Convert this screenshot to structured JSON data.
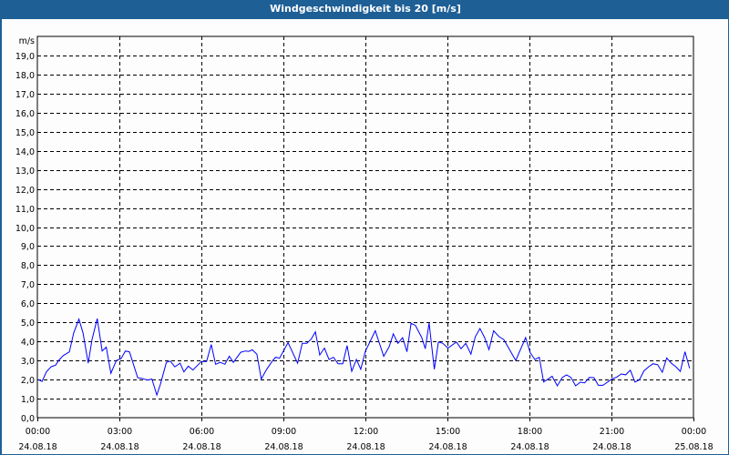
{
  "window": {
    "title": "Windgeschwindigkeit bis 20 [m/s]"
  },
  "chart_data": {
    "type": "line",
    "title": "Windgeschwindigkeit bis 20 [m/s]",
    "ylabel": "m/s",
    "xlabel": "",
    "ylim": [
      0,
      20
    ],
    "xlim_hours": [
      0,
      24
    ],
    "grid": true,
    "y_ticks": [
      "0,0",
      "1,0",
      "2,0",
      "3,0",
      "4,0",
      "5,0",
      "6,0",
      "7,0",
      "8,0",
      "9,0",
      "10,0",
      "11,0",
      "12,0",
      "13,0",
      "14,0",
      "15,0",
      "16,0",
      "17,0",
      "18,0",
      "19,0"
    ],
    "x_ticks": [
      {
        "time": "00:00",
        "date": "24.08.18"
      },
      {
        "time": "03:00",
        "date": "24.08.18"
      },
      {
        "time": "06:00",
        "date": "24.08.18"
      },
      {
        "time": "09:00",
        "date": "24.08.18"
      },
      {
        "time": "12:00",
        "date": "24.08.18"
      },
      {
        "time": "15:00",
        "date": "24.08.18"
      },
      {
        "time": "18:00",
        "date": "24.08.18"
      },
      {
        "time": "21:00",
        "date": "24.08.18"
      },
      {
        "time": "00:00",
        "date": "25.08.18"
      }
    ],
    "series": [
      {
        "name": "Windgeschwindigkeit",
        "color": "#0000ff",
        "x_hours": [
          0.03,
          0.17,
          0.33,
          0.5,
          0.67,
          0.78,
          0.94,
          1.17,
          1.33,
          1.52,
          1.67,
          1.86,
          2.0,
          2.19,
          2.37,
          2.52,
          2.69,
          2.89,
          3.06,
          3.22,
          3.37,
          3.67,
          3.83,
          4.03,
          4.19,
          4.37,
          4.5,
          4.72,
          4.86,
          5.03,
          5.22,
          5.36,
          5.52,
          5.69,
          6.0,
          6.19,
          6.36,
          6.52,
          6.69,
          6.86,
          7.02,
          7.17,
          7.44,
          7.61,
          7.74,
          7.86,
          8.03,
          8.19,
          8.39,
          8.61,
          8.72,
          8.86,
          9.17,
          9.52,
          9.69,
          9.86,
          10.02,
          10.17,
          10.33,
          10.5,
          10.67,
          10.83,
          11.0,
          11.17,
          11.33,
          11.5,
          11.67,
          11.83,
          12.0,
          12.36,
          12.67,
          12.87,
          13.02,
          13.19,
          13.36,
          13.52,
          13.67,
          13.83,
          14.06,
          14.19,
          14.33,
          14.52,
          14.67,
          14.83,
          15.02,
          15.33,
          15.5,
          15.67,
          15.86,
          16.02,
          16.19,
          16.36,
          16.52,
          16.69,
          16.89,
          17.06,
          17.5,
          17.86,
          18.03,
          18.2,
          18.36,
          18.52,
          18.83,
          19.02,
          19.2,
          19.36,
          19.52,
          19.69,
          19.86,
          20.02,
          20.19,
          20.36,
          20.52,
          20.69,
          21.02,
          21.19,
          21.36,
          21.52,
          21.69,
          21.86,
          22.02,
          22.19,
          22.36,
          22.52,
          22.69,
          22.86,
          23.02,
          23.19,
          23.36,
          23.52,
          23.69,
          23.86
        ],
        "values": [
          2.0,
          1.9,
          2.4,
          2.67,
          2.76,
          3.0,
          3.25,
          3.45,
          4.45,
          5.17,
          4.45,
          2.86,
          4.1,
          5.2,
          3.5,
          3.7,
          2.33,
          3.0,
          3.1,
          3.5,
          3.45,
          2.1,
          2.06,
          1.97,
          2.03,
          1.19,
          1.75,
          2.9,
          2.97,
          2.67,
          2.86,
          2.4,
          2.7,
          2.5,
          2.95,
          2.95,
          3.84,
          2.8,
          2.9,
          2.8,
          3.22,
          2.9,
          3.43,
          3.5,
          3.48,
          3.56,
          3.33,
          2.03,
          2.54,
          3.0,
          3.17,
          3.12,
          3.94,
          2.86,
          3.9,
          3.9,
          4.13,
          4.5,
          3.29,
          3.65,
          3.05,
          3.17,
          2.83,
          2.83,
          3.78,
          2.43,
          3.05,
          2.54,
          3.49,
          4.56,
          3.22,
          3.73,
          4.4,
          3.9,
          4.2,
          3.46,
          4.95,
          4.84,
          4.2,
          3.62,
          4.97,
          2.54,
          3.97,
          3.9,
          3.65,
          3.97,
          3.62,
          3.9,
          3.33,
          4.25,
          4.68,
          4.2,
          3.57,
          4.56,
          4.25,
          4.1,
          3.0,
          4.2,
          3.41,
          3.05,
          3.17,
          1.87,
          2.17,
          1.67,
          2.11,
          2.25,
          2.11,
          1.67,
          1.86,
          1.83,
          2.11,
          2.1,
          1.7,
          1.7,
          2.03,
          2.13,
          2.29,
          2.25,
          2.49,
          1.87,
          1.98,
          2.46,
          2.67,
          2.83,
          2.78,
          2.38,
          3.13,
          2.86,
          2.67,
          2.43,
          3.46,
          2.59
        ]
      }
    ]
  }
}
